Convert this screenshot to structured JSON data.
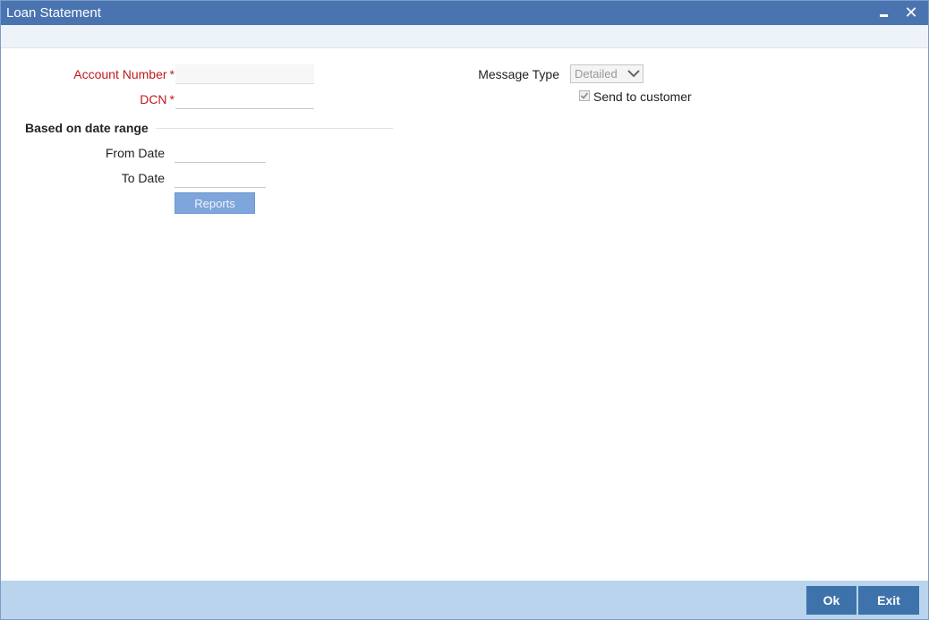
{
  "window": {
    "title": "Loan Statement"
  },
  "form": {
    "account_number": {
      "label": "Account Number",
      "required_mark": "*",
      "value": ""
    },
    "dcn": {
      "label": "DCN",
      "required_mark": "*",
      "value": ""
    },
    "message_type": {
      "label": "Message Type",
      "selected": "Detailed"
    },
    "send_to_customer": {
      "label": "Send to customer",
      "checked": true
    },
    "date_range": {
      "heading": "Based on date range",
      "from_date": {
        "label": "From Date",
        "value": ""
      },
      "to_date": {
        "label": "To Date",
        "value": ""
      }
    },
    "reports_label": "Reports"
  },
  "footer": {
    "ok_label": "Ok",
    "exit_label": "Exit"
  },
  "colors": {
    "titlebar": "#4a74b0",
    "mandatory_label": "#c0191f",
    "footer": "#b9d4ec",
    "footer_button": "#3e72aa",
    "reports_button": "#7ea6dc"
  }
}
